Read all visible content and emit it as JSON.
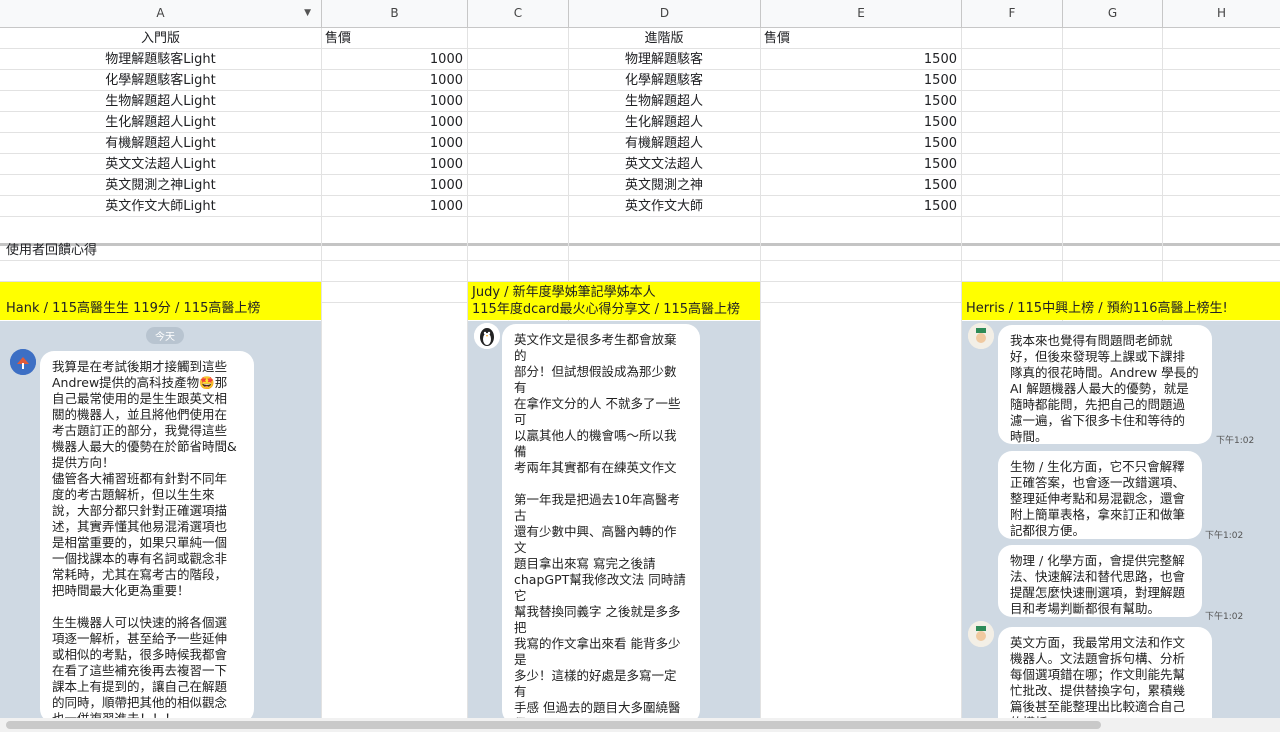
{
  "columns": [
    "A",
    "B",
    "C",
    "D",
    "E",
    "F",
    "G",
    "H"
  ],
  "header": {
    "entry_label": "入門版",
    "entry_price_label": "售價",
    "adv_label": "進階版",
    "adv_price_label": "售價"
  },
  "entry_products": [
    {
      "name": "物理解題駭客Light",
      "price": "1000"
    },
    {
      "name": "化學解題駭客Light",
      "price": "1000"
    },
    {
      "name": "生物解題超人Light",
      "price": "1000"
    },
    {
      "name": "生化解題超人Light",
      "price": "1000"
    },
    {
      "name": "有機解題超人Light",
      "price": "1000"
    },
    {
      "name": "英文文法超人Light",
      "price": "1000"
    },
    {
      "name": "英文閱測之神Light",
      "price": "1000"
    },
    {
      "name": "英文作文大師Light",
      "price": "1000"
    }
  ],
  "adv_products": [
    {
      "name": "物理解題駭客",
      "price": "1500"
    },
    {
      "name": "化學解題駭客",
      "price": "1500"
    },
    {
      "name": "生物解題超人",
      "price": "1500"
    },
    {
      "name": "生化解題超人",
      "price": "1500"
    },
    {
      "name": "有機解題超人",
      "price": "1500"
    },
    {
      "name": "英文文法超人",
      "price": "1500"
    },
    {
      "name": "英文閱測之神",
      "price": "1500"
    },
    {
      "name": "英文作文大師",
      "price": "1500"
    }
  ],
  "feedback_title": "使用者回饋心得",
  "testimonials": {
    "hank": {
      "header": "Hank / 115高醫生生 119分 / 115高醫上榜",
      "day_label": "今天",
      "message": "我算是在考試後期才接觸到這些\nAndrew提供的高科技產物🤩那\n自己最常使用的是生生跟英文相\n關的機器人，並且將他們使用在\n考古題訂正的部分，我覺得這些\n機器人最大的優勢在於節省時間&\n提供方向！\n儘管各大補習班都有針對不同年\n度的考古題解析，但以生生來\n說，大部分都只針對正確選項描\n述，其實弄懂其他易混淆選項也\n是相當重要的，如果只單純一個\n一個找課本的專有名詞或觀念非\n常耗時，尤其在寫考古的階段，\n把時間最大化更為重要！\n\n生生機器人可以快速的將各個選\n項逐一解析，甚至給予一些延伸\n或相似的考點，很多時候我都會\n在看了這些補充後再去複習一下\n課本上有提到的，讓自己在解題\n的同時，順帶把其他的相似觀念\n也一併複習進去！！！"
    },
    "judy": {
      "header_line1": "Judy / 新年度學姊筆記學姊本人",
      "header_line2": "115年度dcard最火心得分享文 / 115高醫上榜",
      "message": "英文作文是很多考生都會放棄的\n部分！但試想假設成為那少數有\n在拿作文分的人 不就多了一些可\n以贏其他人的機會嗎～所以我備\n考兩年其實都有在練英文作文\n\n第一年我是把過去10年高醫考古\n還有少數中興、高醫內轉的作文\n題目拿出來寫 寫完之後請\nchapGPT幫我修改文法 同時請它\n幫我替換同義字 之後就是多多把\n我寫的作文拿出來看 能背多少是\n多少！這樣的好處是多寫一定有\n手感 但過去的題目大多圍繞醫學\n人文 所以我只練了這個領域的作\n文 結果114作文出了一題科學方\n法什麼的 完全寫不出來...但我還\n是硬寫了 花了40分鐘 整個步調\n與節奏亂掉 另一個點是chapGPT\n改出來的文章往往用字艱深 完全\n不是我自己能寫出來的句子哈哈\n哈😅結果就是很難背起來\n\n後來我發現高醫的題目越出越難\n以預測和捉摸 (這次的物化真的很\n讓人傻眼😅😅)可能真的很難預\n測會出什麼領域的題目了 所以\nAndrew學長的作文機器人就給我"
    },
    "herris": {
      "header": "Herris / 115中興上榜 / 預約116高醫上榜生!",
      "messages": [
        {
          "text": "我本來也覺得有問題問老師就\n好，但後來發現等上課或下課排\n隊真的很花時間。Andrew 學長的\nAI 解題機器人最大的優勢，就是\n隨時都能問，先把自己的問題過\n濾一遍，省下很多卡住和等待的\n時間。",
          "time": "下午1:02"
        },
        {
          "text": "生物 / 生化方面，它不只會解釋\n正確答案，也會逐一改錯選項、\n整理延伸考點和易混觀念，還會\n附上簡單表格，拿來訂正和做筆\n記都很方便。",
          "time": "下午1:02"
        },
        {
          "text": "物理 / 化學方面，會提供完整解\n法、快速解法和替代思路，也會\n提醒怎麼快速刪選項，對理解題\n目和考場判斷都很有幫助。",
          "time": "下午1:02"
        },
        {
          "text": "英文方面，我最常用文法和作文\n機器人。文法題會拆句構、分析\n每個選項錯在哪；作文則能先幫\n忙批改、提供替換字句，累積幾\n篇後甚至能整理出比較適合自己\n的模板。",
          "time": ""
        }
      ]
    }
  },
  "colors": {
    "highlight": "#ffff00",
    "chat_bg": "#cfd9e3",
    "bubble": "#ffffff"
  }
}
